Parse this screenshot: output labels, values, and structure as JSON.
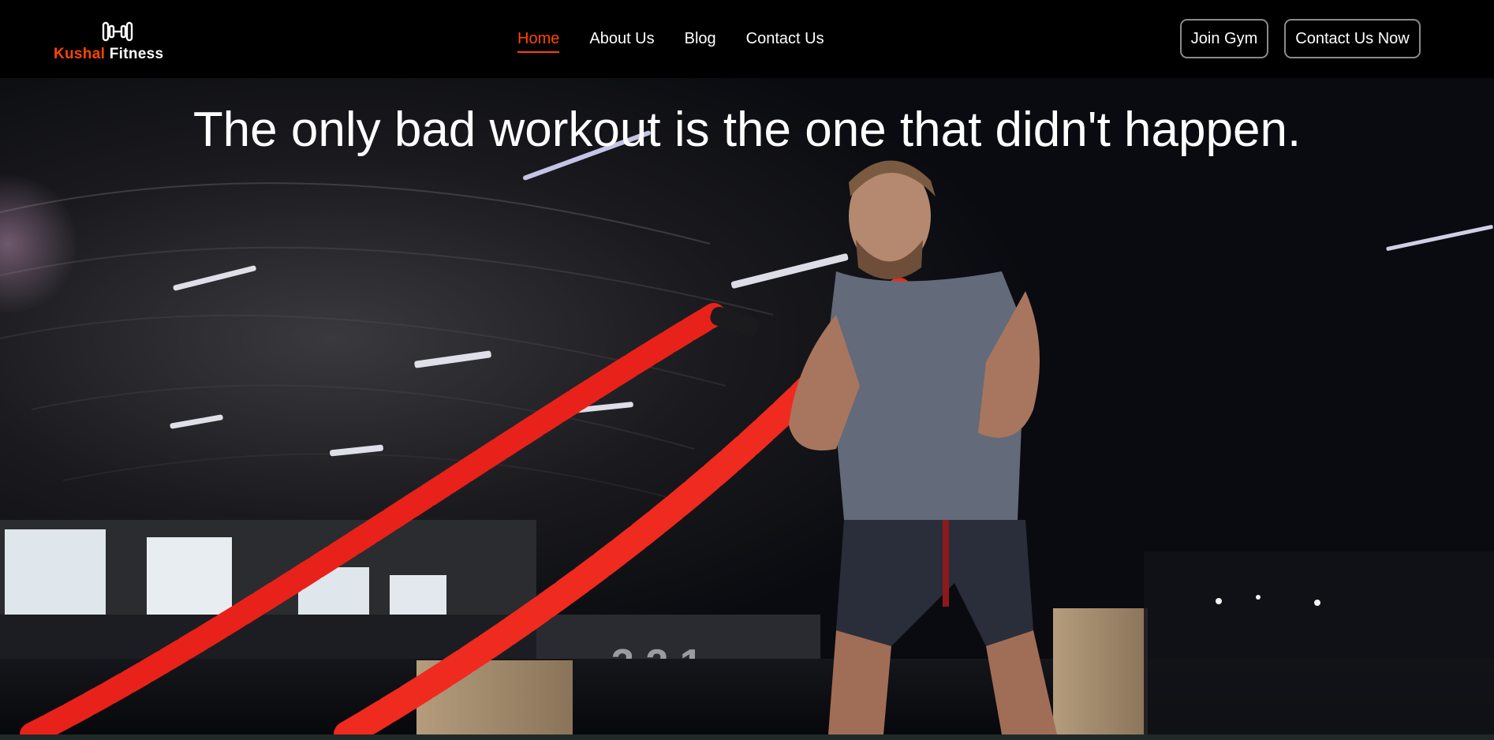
{
  "brand": {
    "accent": "Kushal",
    "rest": "Fitness",
    "icon": "dumbbell-icon",
    "accent_color": "#ff4500"
  },
  "nav": {
    "links": [
      {
        "label": "Home",
        "active": true
      },
      {
        "label": "About Us",
        "active": false
      },
      {
        "label": "Blog",
        "active": false
      },
      {
        "label": "Contact Us",
        "active": false
      }
    ],
    "join_label": "Join Gym",
    "contact_label": "Contact Us Now"
  },
  "hero": {
    "headline": "The only bad workout is the one that didn't happen.",
    "image": "athlete-battle-ropes-photo",
    "rope_color": "#e8221a"
  }
}
